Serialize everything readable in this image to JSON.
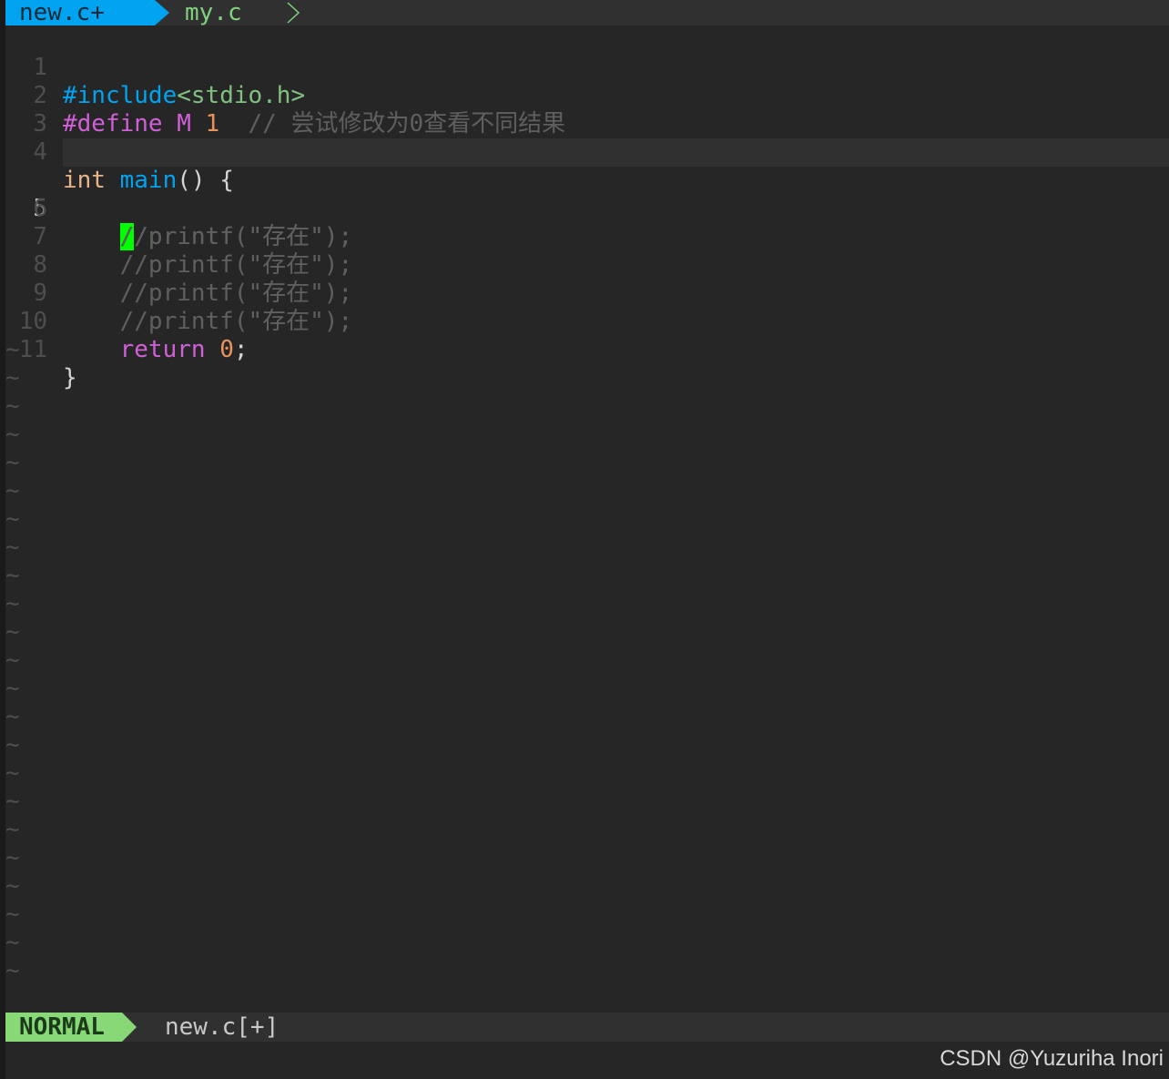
{
  "tabline": {
    "active_tab": "new.c+",
    "inactive_tab": "my.c"
  },
  "editor": {
    "lines": [
      {
        "num": "1",
        "parts": [
          "#include",
          "<stdio.h>"
        ]
      },
      {
        "num": "2",
        "parts": [
          "#define",
          " M ",
          "1",
          "  // 尝试修改为0查看不同结果"
        ]
      },
      {
        "num": "3",
        "parts": []
      },
      {
        "num": "4",
        "parts": [
          "int",
          " ",
          "main",
          "() {"
        ]
      },
      {
        "num": "5",
        "parts": [
          "    ",
          "/",
          "/printf(\"存在\");"
        ]
      },
      {
        "num": "6",
        "parts": [
          "    //printf(\"存在\");"
        ]
      },
      {
        "num": "7",
        "parts": [
          "    //printf(\"存在\");"
        ]
      },
      {
        "num": "8",
        "parts": [
          "    //printf(\"存在\");"
        ]
      },
      {
        "num": "9",
        "parts": [
          "    //printf(\"存在\");"
        ]
      },
      {
        "num": "10",
        "parts": [
          "    ",
          "return",
          " ",
          "0",
          ";"
        ]
      },
      {
        "num": "11",
        "parts": [
          "}"
        ]
      }
    ],
    "tilde": "~"
  },
  "statusline": {
    "mode": "NORMAL",
    "file": "new.c[+]"
  },
  "watermark": "CSDN @Yuzuriha  Inori"
}
